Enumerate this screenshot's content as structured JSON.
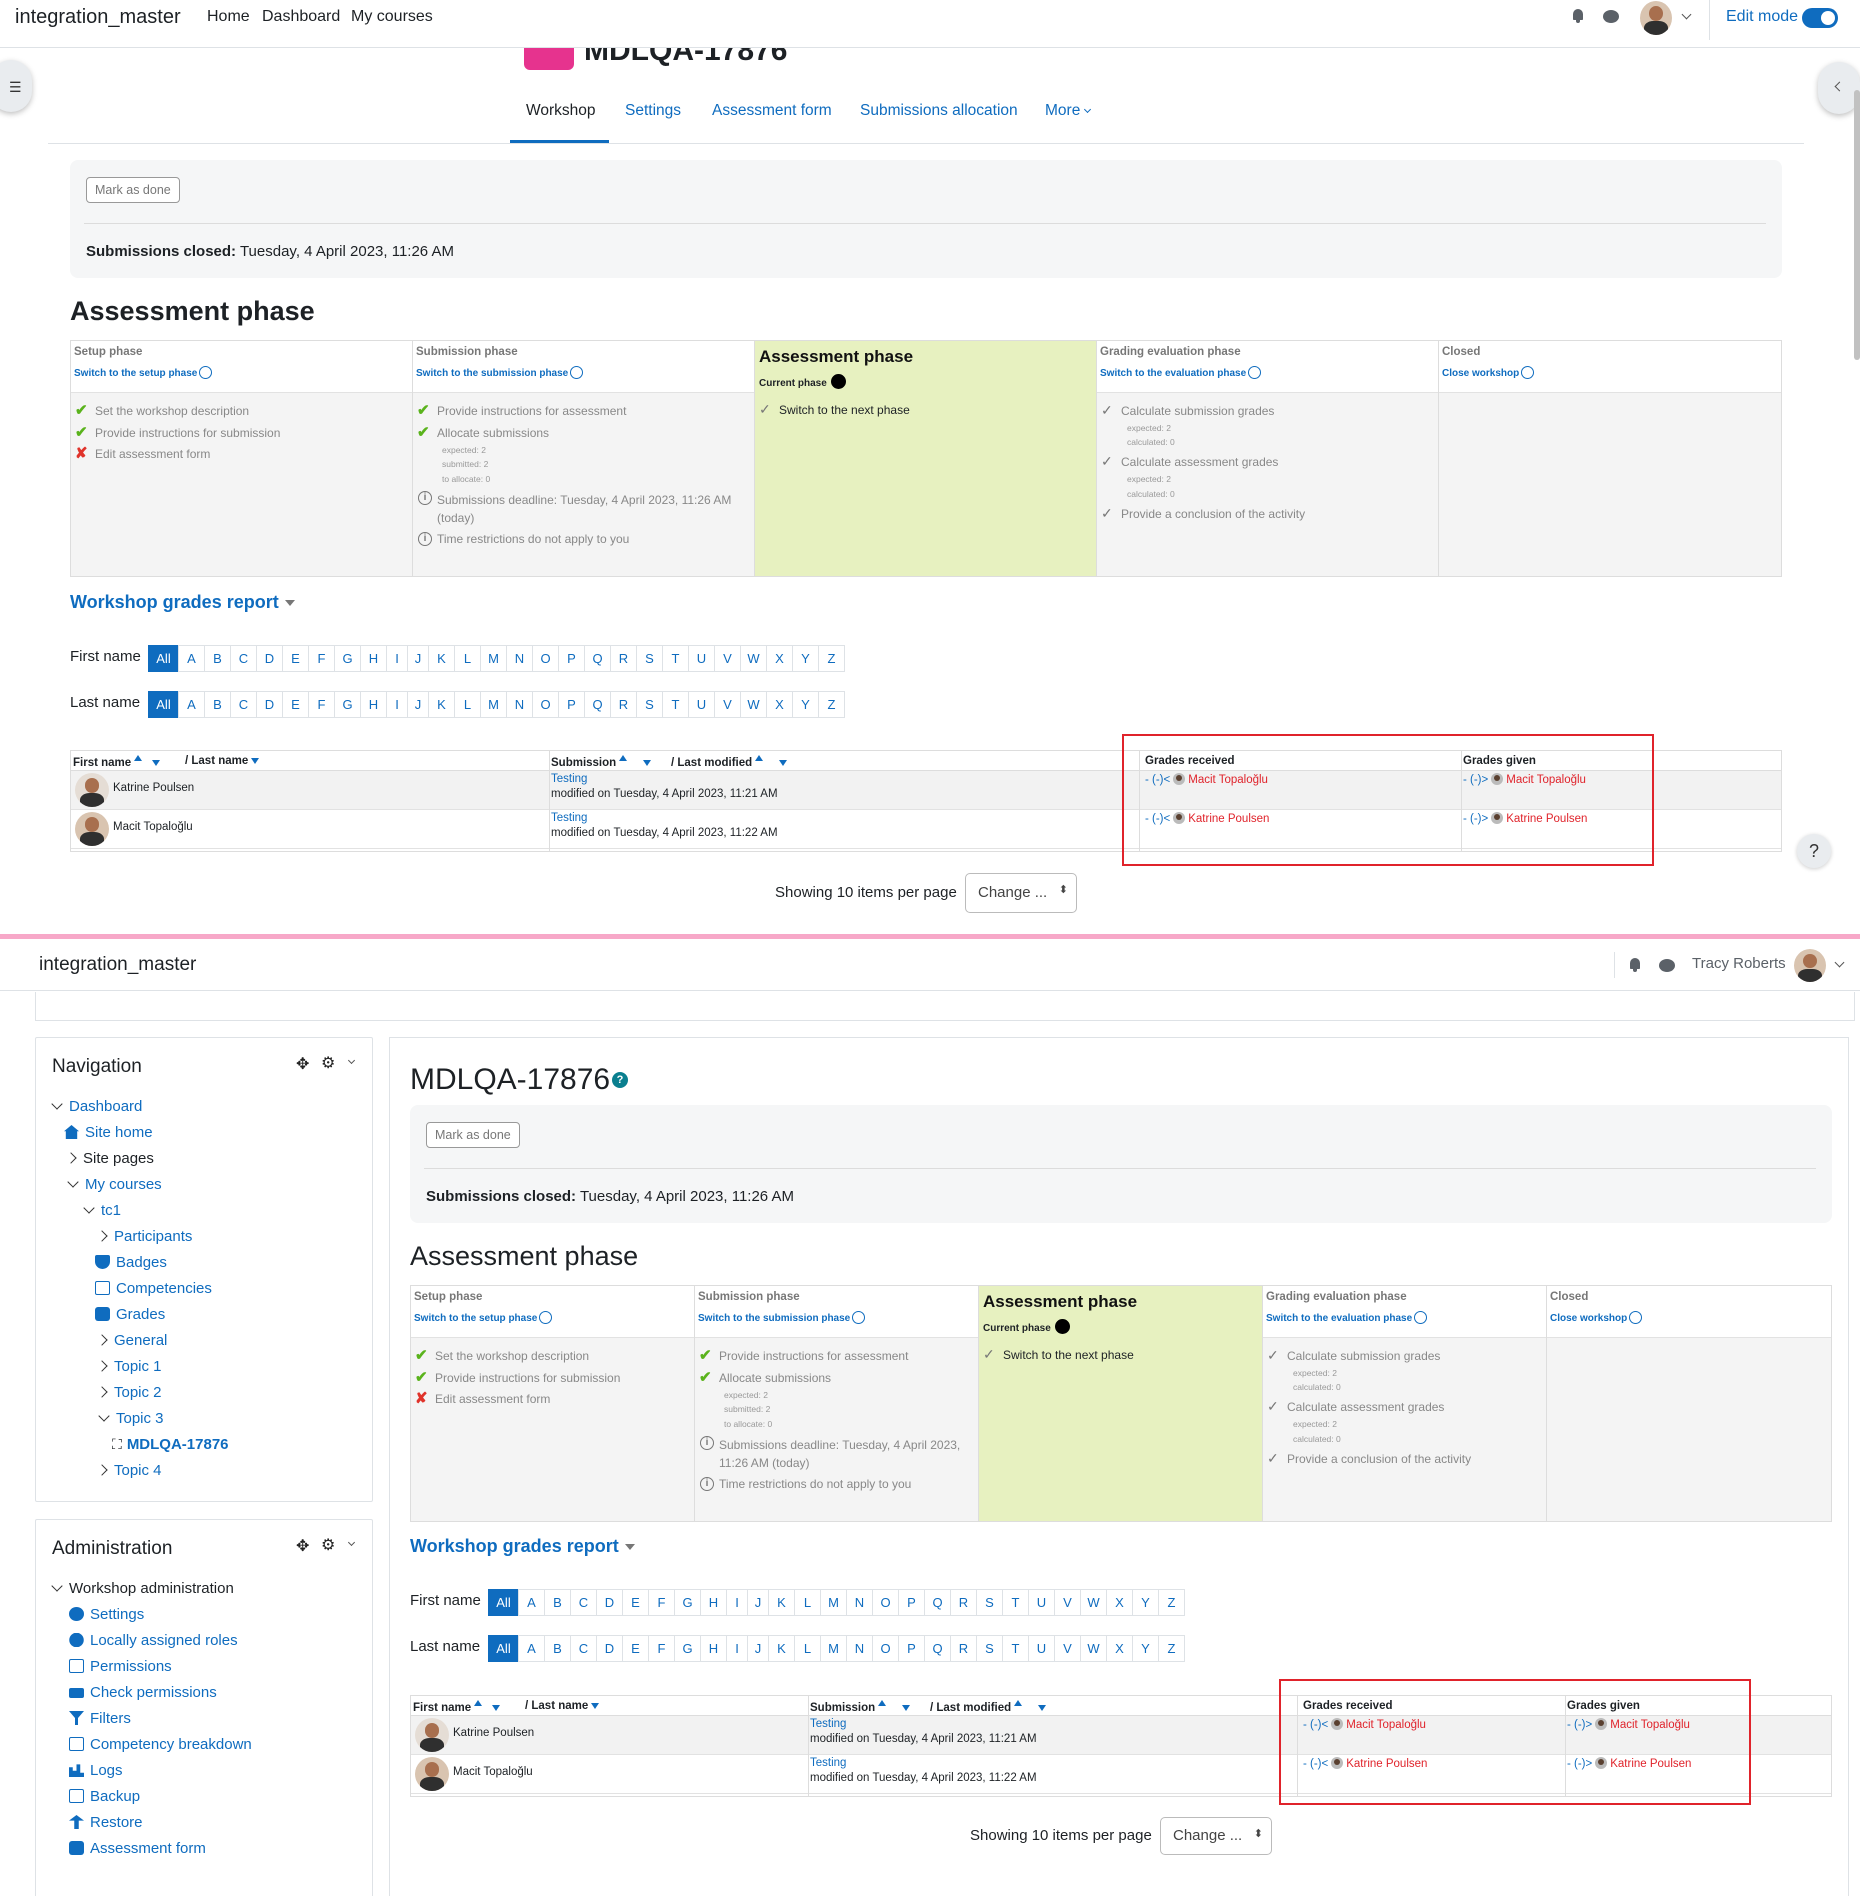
{
  "top": {
    "brand": "integration_master",
    "nav": [
      "Home",
      "Dashboard",
      "My courses"
    ],
    "edit_mode_label": "Edit mode",
    "page_title": "MDLQA-17876",
    "tabs": [
      "Workshop",
      "Settings",
      "Assessment form",
      "Submissions allocation",
      "More"
    ]
  },
  "bottom": {
    "brand": "integration_master",
    "user_name": "Tracy Roberts",
    "page_title": "MDLQA-17876",
    "navigation": {
      "title": "Navigation",
      "items": [
        "Dashboard",
        "Site home",
        "Site pages",
        "My courses",
        "tc1",
        "Participants",
        "Badges",
        "Competencies",
        "Grades",
        "General",
        "Topic 1",
        "Topic 2",
        "Topic 3",
        "MDLQA-17876",
        "Topic 4"
      ]
    },
    "administration": {
      "title": "Administration",
      "items": [
        "Workshop administration",
        "Settings",
        "Locally assigned roles",
        "Permissions",
        "Check permissions",
        "Filters",
        "Competency breakdown",
        "Logs",
        "Backup",
        "Restore",
        "Assessment form"
      ]
    }
  },
  "workshop": {
    "mark_done": "Mark as done",
    "closed_label": "Submissions closed:",
    "closed_value": "Tuesday, 4 April 2023, 11:26 AM",
    "phase_heading": "Assessment phase",
    "phases": {
      "setup": {
        "title": "Setup phase",
        "switch": "Switch to the setup phase",
        "tasks": [
          "Set the workshop description",
          "Provide instructions for submission",
          "Edit assessment form"
        ]
      },
      "submission": {
        "title": "Submission phase",
        "switch": "Switch to the submission phase",
        "tasks": [
          "Provide instructions for assessment",
          "Allocate submissions"
        ],
        "alloc_details": [
          "expected: 2",
          "submitted: 2",
          "to allocate: 0"
        ],
        "deadline": "Submissions deadline: Tuesday, 4 April 2023, 11:26 AM (today)",
        "deadline_a": "Submissions deadline: Tuesday, 4 April 2023, 11:26 AM",
        "deadline_b": "(today)",
        "deadline_c": "Submissions deadline: Tuesday, 4 April 2023,",
        "deadline_d": "11:26 AM (today)",
        "restriction": "Time restrictions do not apply to you"
      },
      "assessment": {
        "title": "Assessment phase",
        "current": "Current phase",
        "task": "Switch to the next phase"
      },
      "grading": {
        "title": "Grading evaluation phase",
        "switch": "Switch to the evaluation phase",
        "task1": "Calculate submission grades",
        "task2": "Calculate assessment grades",
        "task3": "Provide a conclusion of the activity",
        "expected": "expected: 2",
        "calculated": "calculated: 0"
      },
      "closed": {
        "title": "Closed",
        "switch": "Close workshop"
      }
    },
    "report_title": "Workshop grades report",
    "first_name_label": "First name",
    "last_name_label": "Last name",
    "initials": [
      "All",
      "A",
      "B",
      "C",
      "D",
      "E",
      "F",
      "G",
      "H",
      "I",
      "J",
      "K",
      "L",
      "M",
      "N",
      "O",
      "P",
      "Q",
      "R",
      "S",
      "T",
      "U",
      "V",
      "W",
      "X",
      "Y",
      "Z"
    ],
    "table": {
      "col_first": "First name",
      "col_last": "/ Last name",
      "col_submission": "Submission",
      "col_modified": "/ Last modified",
      "col_received": "Grades received",
      "col_given": "Grades given",
      "rows": [
        {
          "name": "Katrine Poulsen",
          "submission": "Testing",
          "modified": "modified on Tuesday, 4 April 2023, 11:21 AM",
          "received_prefix": "- (-)<",
          "received_name": "Macit Topaloğlu",
          "given_prefix": "- (-)>",
          "given_name": "Macit Topaloğlu"
        },
        {
          "name": "Macit Topaloğlu",
          "submission": "Testing",
          "modified": "modified on Tuesday, 4 April 2023, 11:22 AM",
          "received_prefix": "- (-)<",
          "received_name": "Katrine Poulsen",
          "given_prefix": "- (-)>",
          "given_name": "Katrine Poulsen"
        }
      ]
    },
    "paging": "Showing 10 items per page",
    "change": "Change ..."
  },
  "colors": {
    "link": "#0f6cbf",
    "current_phase_bg": "#e7f1c0",
    "highlight_box": "#e0232b",
    "divider": "#f7a8c8"
  }
}
